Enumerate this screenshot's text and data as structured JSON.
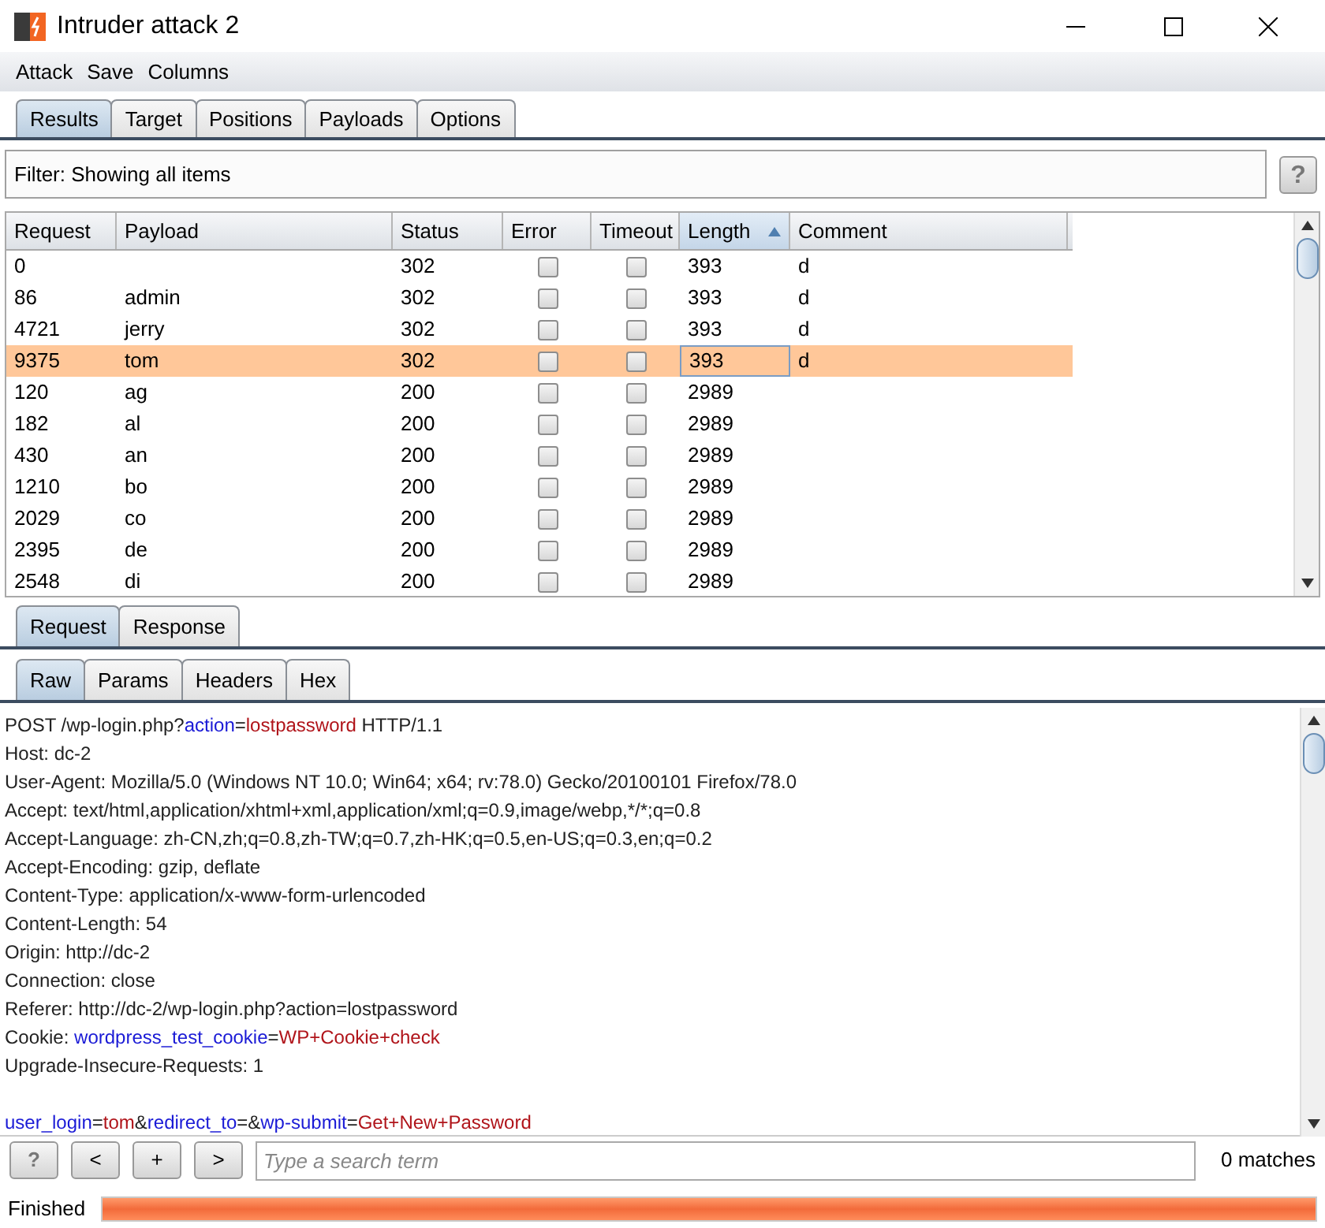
{
  "window": {
    "title": "Intruder attack 2"
  },
  "menu": [
    "Attack",
    "Save",
    "Columns"
  ],
  "tabs": [
    {
      "label": "Results",
      "selected": true
    },
    {
      "label": "Target",
      "selected": false
    },
    {
      "label": "Positions",
      "selected": false
    },
    {
      "label": "Payloads",
      "selected": false
    },
    {
      "label": "Options",
      "selected": false
    }
  ],
  "filter": {
    "text": "Filter: Showing all items",
    "help": "?"
  },
  "table": {
    "columns": [
      {
        "label": "Request",
        "sorted": false
      },
      {
        "label": "Payload",
        "sorted": false
      },
      {
        "label": "Status",
        "sorted": false
      },
      {
        "label": "Error",
        "sorted": false
      },
      {
        "label": "Timeout",
        "sorted": false
      },
      {
        "label": "Length",
        "sorted": true
      },
      {
        "label": "Comment",
        "sorted": false
      }
    ],
    "rows": [
      {
        "request": "0",
        "payload": "",
        "status": "302",
        "error": false,
        "timeout": false,
        "length": "393",
        "comment": "d",
        "selected": false
      },
      {
        "request": "86",
        "payload": "admin",
        "status": "302",
        "error": false,
        "timeout": false,
        "length": "393",
        "comment": "d",
        "selected": false
      },
      {
        "request": "4721",
        "payload": "jerry",
        "status": "302",
        "error": false,
        "timeout": false,
        "length": "393",
        "comment": "d",
        "selected": false
      },
      {
        "request": "9375",
        "payload": "tom",
        "status": "302",
        "error": false,
        "timeout": false,
        "length": "393",
        "comment": "d",
        "selected": true
      },
      {
        "request": "120",
        "payload": "ag",
        "status": "200",
        "error": false,
        "timeout": false,
        "length": "2989",
        "comment": "",
        "selected": false
      },
      {
        "request": "182",
        "payload": "al",
        "status": "200",
        "error": false,
        "timeout": false,
        "length": "2989",
        "comment": "",
        "selected": false
      },
      {
        "request": "430",
        "payload": "an",
        "status": "200",
        "error": false,
        "timeout": false,
        "length": "2989",
        "comment": "",
        "selected": false
      },
      {
        "request": "1210",
        "payload": "bo",
        "status": "200",
        "error": false,
        "timeout": false,
        "length": "2989",
        "comment": "",
        "selected": false
      },
      {
        "request": "2029",
        "payload": "co",
        "status": "200",
        "error": false,
        "timeout": false,
        "length": "2989",
        "comment": "",
        "selected": false
      },
      {
        "request": "2395",
        "payload": "de",
        "status": "200",
        "error": false,
        "timeout": false,
        "length": "2989",
        "comment": "",
        "selected": false
      },
      {
        "request": "2548",
        "payload": "di",
        "status": "200",
        "error": false,
        "timeout": false,
        "length": "2989",
        "comment": "",
        "selected": false
      }
    ]
  },
  "message_tabs": [
    {
      "label": "Request",
      "selected": true
    },
    {
      "label": "Response",
      "selected": false
    }
  ],
  "view_tabs": [
    {
      "label": "Raw",
      "selected": true
    },
    {
      "label": "Params",
      "selected": false
    },
    {
      "label": "Headers",
      "selected": false
    },
    {
      "label": "Hex",
      "selected": false
    }
  ],
  "raw_lines": [
    [
      {
        "kind": "plain",
        "text": "POST /wp-login.php?"
      },
      {
        "kind": "name",
        "text": "action"
      },
      {
        "kind": "plain",
        "text": "="
      },
      {
        "kind": "value",
        "text": "lostpassword"
      },
      {
        "kind": "plain",
        "text": " HTTP/1.1"
      }
    ],
    [
      {
        "kind": "plain",
        "text": "Host: dc-2"
      }
    ],
    [
      {
        "kind": "plain",
        "text": "User-Agent: Mozilla/5.0 (Windows NT 10.0; Win64; x64; rv:78.0) Gecko/20100101 Firefox/78.0"
      }
    ],
    [
      {
        "kind": "plain",
        "text": "Accept: text/html,application/xhtml+xml,application/xml;q=0.9,image/webp,*/*;q=0.8"
      }
    ],
    [
      {
        "kind": "plain",
        "text": "Accept-Language: zh-CN,zh;q=0.8,zh-TW;q=0.7,zh-HK;q=0.5,en-US;q=0.3,en;q=0.2"
      }
    ],
    [
      {
        "kind": "plain",
        "text": "Accept-Encoding: gzip, deflate"
      }
    ],
    [
      {
        "kind": "plain",
        "text": "Content-Type: application/x-www-form-urlencoded"
      }
    ],
    [
      {
        "kind": "plain",
        "text": "Content-Length: 54"
      }
    ],
    [
      {
        "kind": "plain",
        "text": "Origin: http://dc-2"
      }
    ],
    [
      {
        "kind": "plain",
        "text": "Connection: close"
      }
    ],
    [
      {
        "kind": "plain",
        "text": "Referer: http://dc-2/wp-login.php?action=lostpassword"
      }
    ],
    [
      {
        "kind": "plain",
        "text": "Cookie: "
      },
      {
        "kind": "name",
        "text": "wordpress_test_cookie"
      },
      {
        "kind": "plain",
        "text": "="
      },
      {
        "kind": "value",
        "text": "WP+Cookie+check"
      }
    ],
    [
      {
        "kind": "plain",
        "text": "Upgrade-Insecure-Requests: 1"
      }
    ]
  ],
  "body_lines": [
    [
      {
        "kind": "name",
        "text": "user_login"
      },
      {
        "kind": "plain",
        "text": "="
      },
      {
        "kind": "value",
        "text": "tom"
      },
      {
        "kind": "plain",
        "text": "&"
      },
      {
        "kind": "name",
        "text": "redirect_to"
      },
      {
        "kind": "plain",
        "text": "=&"
      },
      {
        "kind": "name",
        "text": "wp-submit"
      },
      {
        "kind": "plain",
        "text": "="
      },
      {
        "kind": "value",
        "text": "Get+New+Password"
      }
    ]
  ],
  "search": {
    "buttons": [
      "?",
      "<",
      "+",
      ">"
    ],
    "placeholder": "Type a search term",
    "matches": "0 matches"
  },
  "status": {
    "text": "Finished",
    "level": 1
  }
}
